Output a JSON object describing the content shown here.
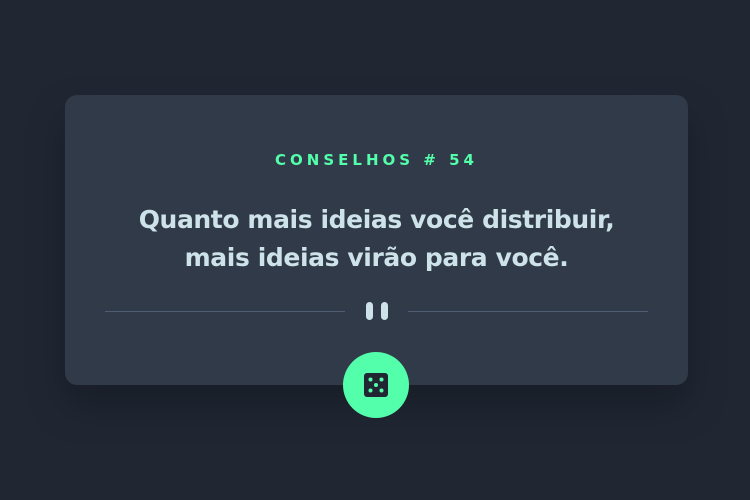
{
  "advice": {
    "id_label": "CONSELHOS # 54",
    "quote_line1": "Quanto mais ideias você distribuir,",
    "quote_line2": "mais ideias virão para você."
  },
  "icons": {
    "divider": "pause-icon",
    "button": "dice-icon"
  },
  "colors": {
    "background": "#202733",
    "card": "#313a48",
    "accent": "#53ffaa",
    "text": "#cee3e9",
    "divider": "#4f5d74"
  }
}
